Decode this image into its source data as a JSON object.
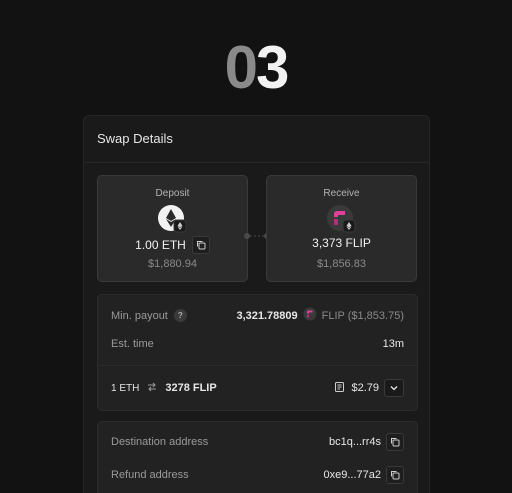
{
  "step": {
    "digit_dim": "0",
    "digit_bright": "3"
  },
  "panel": {
    "title": "Swap Details"
  },
  "deposit": {
    "label": "Deposit",
    "amount": "1.00 ETH",
    "usd": "$1,880.94",
    "icon": "eth-token-icon"
  },
  "receive": {
    "label": "Receive",
    "amount": "3,373 FLIP",
    "usd": "$1,856.83",
    "icon": "flip-token-icon"
  },
  "details": {
    "min_payout_label": "Min. payout",
    "min_payout_value": "3,321.78809",
    "min_payout_token": "FLIP ($1,853.75)",
    "est_time_label": "Est. time",
    "est_time_value": "13m",
    "rate_left": "1 ETH",
    "rate_right": "3278 FLIP",
    "fee_value": "$2.79"
  },
  "addresses": {
    "destination_label": "Destination address",
    "destination_value": "bc1q...rr4s",
    "refund_label": "Refund address",
    "refund_value": "0xe9...77a2"
  },
  "colors": {
    "background": "#121212",
    "panel": "#1a1a1a",
    "card": "#2a2a2a",
    "flip_pink": "#e0409a"
  }
}
